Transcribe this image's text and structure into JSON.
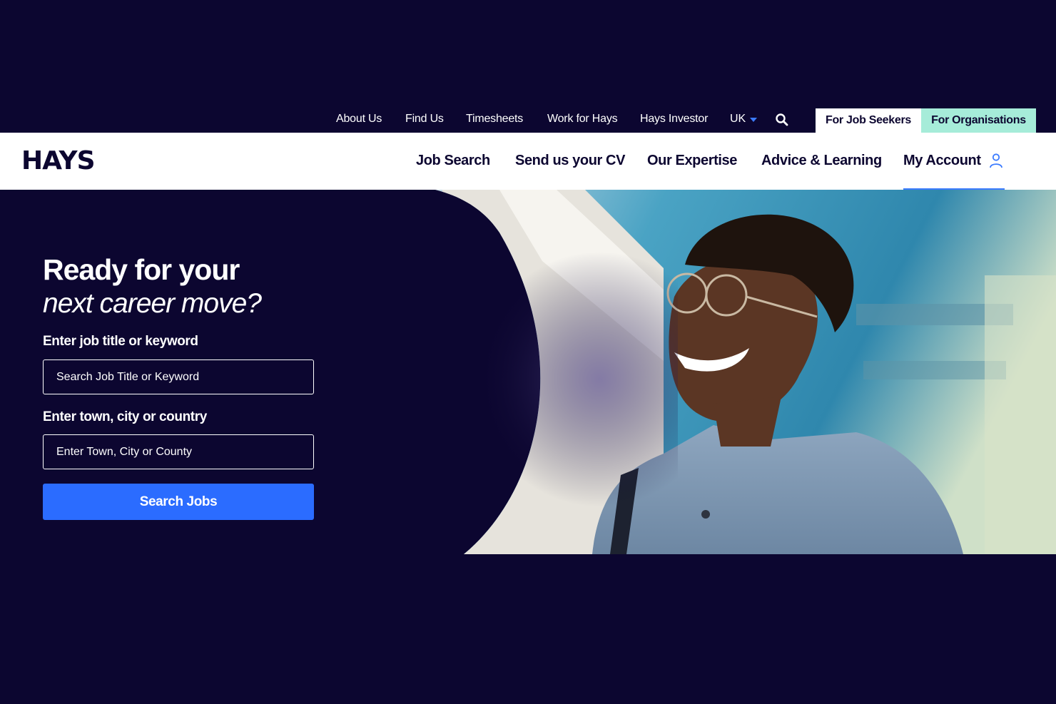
{
  "utility_nav": {
    "links": [
      "About Us",
      "Find Us",
      "Timesheets",
      "Work for Hays",
      "Hays Investor"
    ],
    "region": "UK",
    "search_icon": "search-icon",
    "audience_tabs": [
      "For Job Seekers",
      "For Organisations"
    ]
  },
  "header": {
    "logo": "HAYS",
    "nav": [
      "Job Search",
      "Send us your CV",
      "Our Expertise",
      "Advice & Learning"
    ],
    "account_label": "My Account",
    "account_icon": "user-icon"
  },
  "hero": {
    "headline_line1": "Ready for your",
    "headline_line2": "next career move?",
    "keyword_label": "Enter job title or keyword",
    "keyword_placeholder": "Search Job Title or Keyword",
    "location_label": "Enter town, city or country",
    "location_placeholder": "Enter Town, City or County",
    "button_label": "Search Jobs"
  },
  "colors": {
    "background": "#0c0630",
    "accent_blue": "#2b6cff",
    "organisations_tab": "#a6ecd9"
  }
}
